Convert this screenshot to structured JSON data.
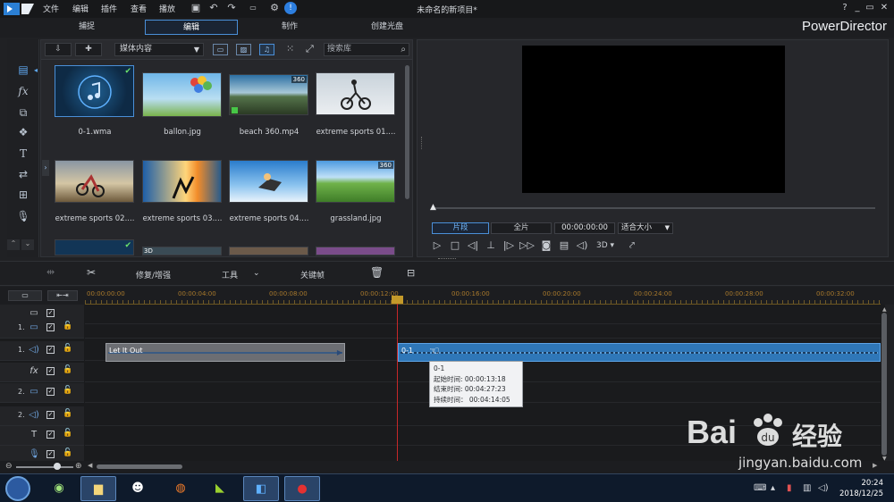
{
  "titlebar": {
    "menus": [
      "文件",
      "编辑",
      "插件",
      "查看",
      "播放"
    ],
    "window_title": "未命名的新项目*",
    "window_controls": [
      "?",
      "_",
      "▭",
      "✕"
    ]
  },
  "modes": {
    "tabs": [
      "捕捉",
      "编辑",
      "制作",
      "创建光盘"
    ],
    "active": "编辑",
    "brand": "PowerDirector"
  },
  "library": {
    "dropdown": "媒体内容",
    "search_placeholder": "搜索库",
    "items": [
      {
        "label": "0-1.wma",
        "kind": "audio",
        "checked": true
      },
      {
        "label": "ballon.jpg",
        "kind": "image"
      },
      {
        "label": "beach 360.mp4",
        "kind": "video360"
      },
      {
        "label": "extreme sports 01....",
        "kind": "image"
      },
      {
        "label": "extreme sports 02....",
        "kind": "image"
      },
      {
        "label": "extreme sports 03....",
        "kind": "image"
      },
      {
        "label": "extreme sports 04....",
        "kind": "image"
      },
      {
        "label": "grassland.jpg",
        "kind": "image360"
      }
    ],
    "badge_360": "360",
    "badge_3d": "3D"
  },
  "preview": {
    "clip_label": "片段",
    "full_label": "全片",
    "timecode": "00:00:00:00",
    "fit_label": "适合大小",
    "threed_label": "3D"
  },
  "edit_toolbar": {
    "fix_enhance": "修复/增强",
    "tools": "工具",
    "keyframe": "关键帧"
  },
  "timeline": {
    "ticks": [
      "00:00:00:00",
      "00:00:04:00",
      "00:00:08:00",
      "00:00:12:00",
      "00:00:16:00",
      "00:00:20:00",
      "00:00:24:00",
      "00:00:28:00",
      "00:00:32:00"
    ],
    "tracks": [
      {
        "num": "",
        "icon": "video-icon"
      },
      {
        "num": "1.",
        "icon": "video-icon"
      },
      {
        "num": "1.",
        "icon": "audio-icon"
      },
      {
        "num": "",
        "icon": "fx-icon"
      },
      {
        "num": "2.",
        "icon": "video-icon"
      },
      {
        "num": "2.",
        "icon": "audio-icon"
      },
      {
        "num": "",
        "icon": "text-icon"
      },
      {
        "num": "",
        "icon": "mic-icon"
      }
    ],
    "clips": [
      {
        "name": "Let It Out"
      },
      {
        "name": "0-1"
      }
    ],
    "tooltip": {
      "title": "0-1",
      "start": "起始时间: 00:00:13:18",
      "end": "结束时间: 00:04:27:23",
      "duration": "持续时间：  00:04:14:05"
    }
  },
  "taskbar": {
    "time": "20:24",
    "date": "2018/12/25"
  },
  "watermark": {
    "brand": "Bai",
    "brand2": "经验",
    "url": "jingyan.baidu.com"
  },
  "colors": {
    "accent": "#4a8fd8",
    "playhead": "#c62828",
    "ruler": "#a8792c",
    "audio_clip": "#2f77b8"
  }
}
